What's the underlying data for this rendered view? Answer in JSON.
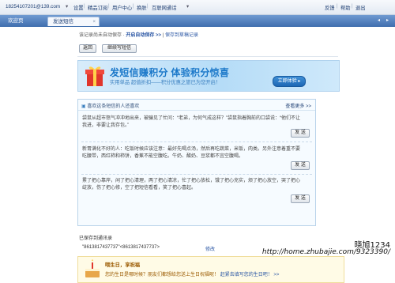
{
  "topbar": {
    "account": "18254107201@139.com",
    "settings": "设置",
    "subscribe": "精品订阅",
    "user_center": "用户中心",
    "skin": "换肤",
    "im": "互联网通话",
    "feedback": "反馈",
    "help": "帮助",
    "logout": "退出"
  },
  "tabs": [
    {
      "label": "欢迎页"
    },
    {
      "label": "发送短信",
      "close": "×"
    }
  ],
  "compose": {
    "autosave_prefix": "该记录尚未自动保存 ·",
    "autosave_link": "开启自动保存 >>",
    "autosave_sep": "|",
    "save_record": "保存到草稿记录",
    "back_button": "返回",
    "continue_button": "继续写短信"
  },
  "banner": {
    "title": "发短信赚积分 体验积分惊喜",
    "subtitle": "实用单品 超值折扣——积分优惠之旅已为您开启！",
    "button": "立即体验 ▸"
  },
  "recommend": {
    "title": "喜欢这条短信的人还喜欢",
    "more": "查看更多 >>",
    "messages": [
      {
        "text": "袋鼠从超市怒气冲冲地出来，被骗见了忙问：“老弟，为何气成这样？”袋鼠指着胸前的口袋说：“他们不让我进，非要让我存包。”",
        "send": "发 送"
      },
      {
        "text": "新胃满化不好的人：吃饭时候应该注意：最好先喝点汤，然后再吃蔬菜，米饭，肉类。另外注意着重不要吃腰带，西红柿和柿饼，香蕉不能空腹吃。牛奶、酸奶、豆浆都不宜空腹喝。",
        "send": "发 送"
      },
      {
        "text": "累了把心靠岸，闲了把心清理，两了把心清凉，忙了把心放松，饿了把心充实，烦了把心放空，哭了把心绽放，伤了把心修，空了把短信看看，笑了把心喜起。",
        "send": "发 送"
      }
    ]
  },
  "saved": {
    "label": "已保存到通讯录",
    "recipient": "\"8613817437737\"<8613817437737>",
    "edit": "修改"
  },
  "birthday": {
    "title": "喂生日，享祝福",
    "subtitle_prefix": "您的生日是哪时候？朋友们都想给您送上生日祝福呢！",
    "subtitle_link": "赶紧去填写您的生日吧！ >>"
  },
  "watermarks": {
    "name": "晓旭1234",
    "url": "http://home.zhubajie.com/9323390/"
  }
}
